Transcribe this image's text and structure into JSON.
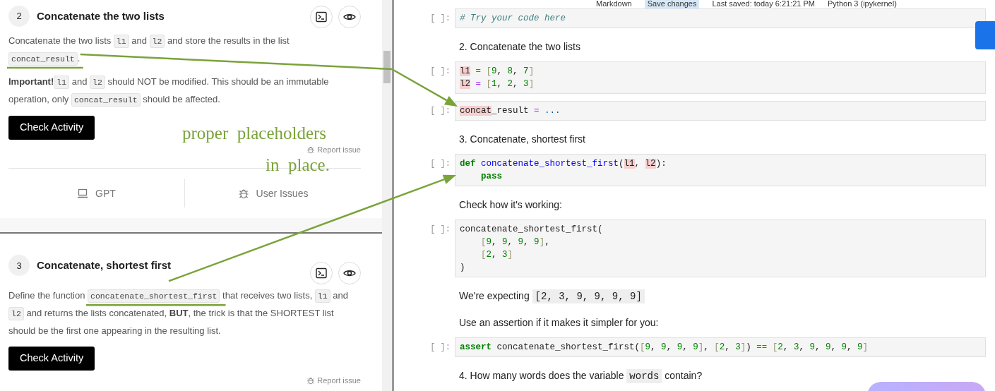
{
  "tasks": [
    {
      "number": "2",
      "title": "Concatenate the two lists",
      "paragraphs": [
        [
          {
            "kind": "text",
            "text": "Concatenate the two lists "
          },
          {
            "kind": "code",
            "text": "l1"
          },
          {
            "kind": "text",
            "text": " and "
          },
          {
            "kind": "code",
            "text": "l2"
          },
          {
            "kind": "text",
            "text": " and store the results in the list "
          },
          {
            "kind": "code",
            "text": "concat_result"
          },
          {
            "kind": "text",
            "text": "."
          }
        ],
        [
          {
            "kind": "bold",
            "text": "Important!"
          },
          {
            "kind": "code",
            "text": "l1"
          },
          {
            "kind": "text",
            "text": " and "
          },
          {
            "kind": "code",
            "text": "l2"
          },
          {
            "kind": "text",
            "text": " should NOT be modified. This should be an immutable operation, only "
          },
          {
            "kind": "code",
            "text": "concat_result"
          },
          {
            "kind": "text",
            "text": " should be affected."
          }
        ]
      ],
      "button": "Check Activity",
      "report": "Report issue",
      "footer": [
        "GPT",
        "User Issues"
      ]
    },
    {
      "number": "3",
      "title": "Concatenate, shortest first",
      "paragraphs": [
        [
          {
            "kind": "text",
            "text": "Define the function "
          },
          {
            "kind": "code",
            "text": "concatenate_shortest_first"
          },
          {
            "kind": "text",
            "text": " that receives two lists, "
          },
          {
            "kind": "code",
            "text": "l1"
          },
          {
            "kind": "text",
            "text": " and "
          },
          {
            "kind": "code",
            "text": "l2"
          },
          {
            "kind": "text",
            "text": " and returns the lists concatenated, "
          },
          {
            "kind": "bold",
            "text": "BUT"
          },
          {
            "kind": "text",
            "text": ", the trick is that the SHORTEST list should be the first one appearing in the resulting list."
          }
        ]
      ],
      "button": "Check Activity",
      "report": "Report issue"
    }
  ],
  "toolbar": {
    "cell_type": "Markdown",
    "save": "Save changes",
    "last_saved": "Last saved: today 6:21:21 PM",
    "kernel": "Python 3 (ipykernel)"
  },
  "cells": [
    {
      "kind": "code",
      "prompt": "[ ]:",
      "lines": [
        [
          {
            "text": "# Try your code here",
            "kind": "comment"
          }
        ]
      ]
    },
    {
      "kind": "markdown",
      "segments": [
        {
          "kind": "text",
          "text": "2. Concatenate the two lists"
        }
      ]
    },
    {
      "kind": "code",
      "prompt": "[ ]:",
      "lines": [
        [
          {
            "text": "l1",
            "kind": "hl"
          },
          {
            "text": " = ",
            "kind": "op"
          },
          {
            "text": "[",
            "kind": "bracket"
          },
          {
            "text": "9",
            "kind": "number"
          },
          {
            "text": ", ",
            "kind": "plain"
          },
          {
            "text": "8",
            "kind": "number"
          },
          {
            "text": ", ",
            "kind": "plain"
          },
          {
            "text": "7",
            "kind": "number"
          },
          {
            "text": "]",
            "kind": "bracket"
          }
        ],
        [
          {
            "text": "l2",
            "kind": "hl"
          },
          {
            "text": " = ",
            "kind": "op"
          },
          {
            "text": "[",
            "kind": "bracket"
          },
          {
            "text": "1",
            "kind": "number"
          },
          {
            "text": ", ",
            "kind": "plain"
          },
          {
            "text": "2",
            "kind": "number"
          },
          {
            "text": ", ",
            "kind": "plain"
          },
          {
            "text": "3",
            "kind": "number"
          },
          {
            "text": "]",
            "kind": "bracket"
          }
        ]
      ]
    },
    {
      "kind": "code",
      "prompt": "[ ]:",
      "lines": [
        [
          {
            "text": "concat",
            "kind": "hl"
          },
          {
            "text": "_result ",
            "kind": "plain"
          },
          {
            "text": "= ",
            "kind": "op"
          },
          {
            "text": "...",
            "kind": "ellipsis"
          }
        ]
      ]
    },
    {
      "kind": "markdown",
      "segments": [
        {
          "kind": "text",
          "text": "3. Concatenate, shortest first"
        }
      ]
    },
    {
      "kind": "code",
      "prompt": "[ ]:",
      "lines": [
        [
          {
            "text": "def ",
            "kind": "keyword"
          },
          {
            "text": "concatenate_shortest_first",
            "kind": "function"
          },
          {
            "text": "(",
            "kind": "plain"
          },
          {
            "text": "l1",
            "kind": "hl"
          },
          {
            "text": ", ",
            "kind": "plain"
          },
          {
            "text": "l2",
            "kind": "hl"
          },
          {
            "text": "):",
            "kind": "plain"
          }
        ],
        [
          {
            "text": "    pass",
            "kind": "keyword"
          }
        ]
      ]
    },
    {
      "kind": "markdown",
      "segments": [
        {
          "kind": "text",
          "text": "Check how it's working:"
        }
      ]
    },
    {
      "kind": "code",
      "prompt": "[ ]:",
      "lines": [
        [
          {
            "text": "concatenate_shortest_first(",
            "kind": "plain"
          }
        ],
        [
          {
            "text": "    [",
            "kind": "bracket"
          },
          {
            "text": "9",
            "kind": "number"
          },
          {
            "text": ", ",
            "kind": "plain"
          },
          {
            "text": "9",
            "kind": "number"
          },
          {
            "text": ", ",
            "kind": "plain"
          },
          {
            "text": "9",
            "kind": "number"
          },
          {
            "text": ", ",
            "kind": "plain"
          },
          {
            "text": "9",
            "kind": "number"
          },
          {
            "text": "]",
            "kind": "bracket"
          },
          {
            "text": ",",
            "kind": "plain"
          }
        ],
        [
          {
            "text": "    [",
            "kind": "bracket"
          },
          {
            "text": "2",
            "kind": "number"
          },
          {
            "text": ", ",
            "kind": "plain"
          },
          {
            "text": "3",
            "kind": "number"
          },
          {
            "text": "]",
            "kind": "bracket"
          }
        ],
        [
          {
            "text": ")",
            "kind": "plain"
          }
        ]
      ]
    },
    {
      "kind": "markdown",
      "segments": [
        {
          "kind": "text",
          "text": "We're expecting "
        },
        {
          "kind": "code",
          "text": "[2, 3, 9, 9, 9, 9]"
        }
      ]
    },
    {
      "kind": "markdown",
      "segments": [
        {
          "kind": "text",
          "text": "Use an assertion if it makes it simpler for you:"
        }
      ]
    },
    {
      "kind": "code",
      "prompt": "[ ]:",
      "lines": [
        [
          {
            "text": "assert ",
            "kind": "keyword"
          },
          {
            "text": "concatenate_shortest_first(",
            "kind": "plain"
          },
          {
            "text": "[",
            "kind": "bracket"
          },
          {
            "text": "9",
            "kind": "number"
          },
          {
            "text": ", ",
            "kind": "plain"
          },
          {
            "text": "9",
            "kind": "number"
          },
          {
            "text": ", ",
            "kind": "plain"
          },
          {
            "text": "9",
            "kind": "number"
          },
          {
            "text": ", ",
            "kind": "plain"
          },
          {
            "text": "9",
            "kind": "number"
          },
          {
            "text": "]",
            "kind": "bracket"
          },
          {
            "text": ", ",
            "kind": "plain"
          },
          {
            "text": "[",
            "kind": "bracket"
          },
          {
            "text": "2",
            "kind": "number"
          },
          {
            "text": ", ",
            "kind": "plain"
          },
          {
            "text": "3",
            "kind": "number"
          },
          {
            "text": "]",
            "kind": "bracket"
          },
          {
            "text": ") ",
            "kind": "plain"
          },
          {
            "text": "== ",
            "kind": "op"
          },
          {
            "text": "[",
            "kind": "bracket"
          },
          {
            "text": "2",
            "kind": "number"
          },
          {
            "text": ", ",
            "kind": "plain"
          },
          {
            "text": "3",
            "kind": "number"
          },
          {
            "text": ", ",
            "kind": "plain"
          },
          {
            "text": "9",
            "kind": "number"
          },
          {
            "text": ", ",
            "kind": "plain"
          },
          {
            "text": "9",
            "kind": "number"
          },
          {
            "text": ", ",
            "kind": "plain"
          },
          {
            "text": "9",
            "kind": "number"
          },
          {
            "text": ", ",
            "kind": "plain"
          },
          {
            "text": "9",
            "kind": "number"
          },
          {
            "text": "]",
            "kind": "bracket"
          }
        ]
      ]
    },
    {
      "kind": "markdown",
      "segments": [
        {
          "kind": "text",
          "text": "4. How many words does the variable "
        },
        {
          "kind": "code",
          "text": "words"
        },
        {
          "kind": "text",
          "text": " contain?"
        }
      ]
    }
  ],
  "annotation": {
    "lines": [
      "proper  placeholders",
      "in  place."
    ]
  }
}
